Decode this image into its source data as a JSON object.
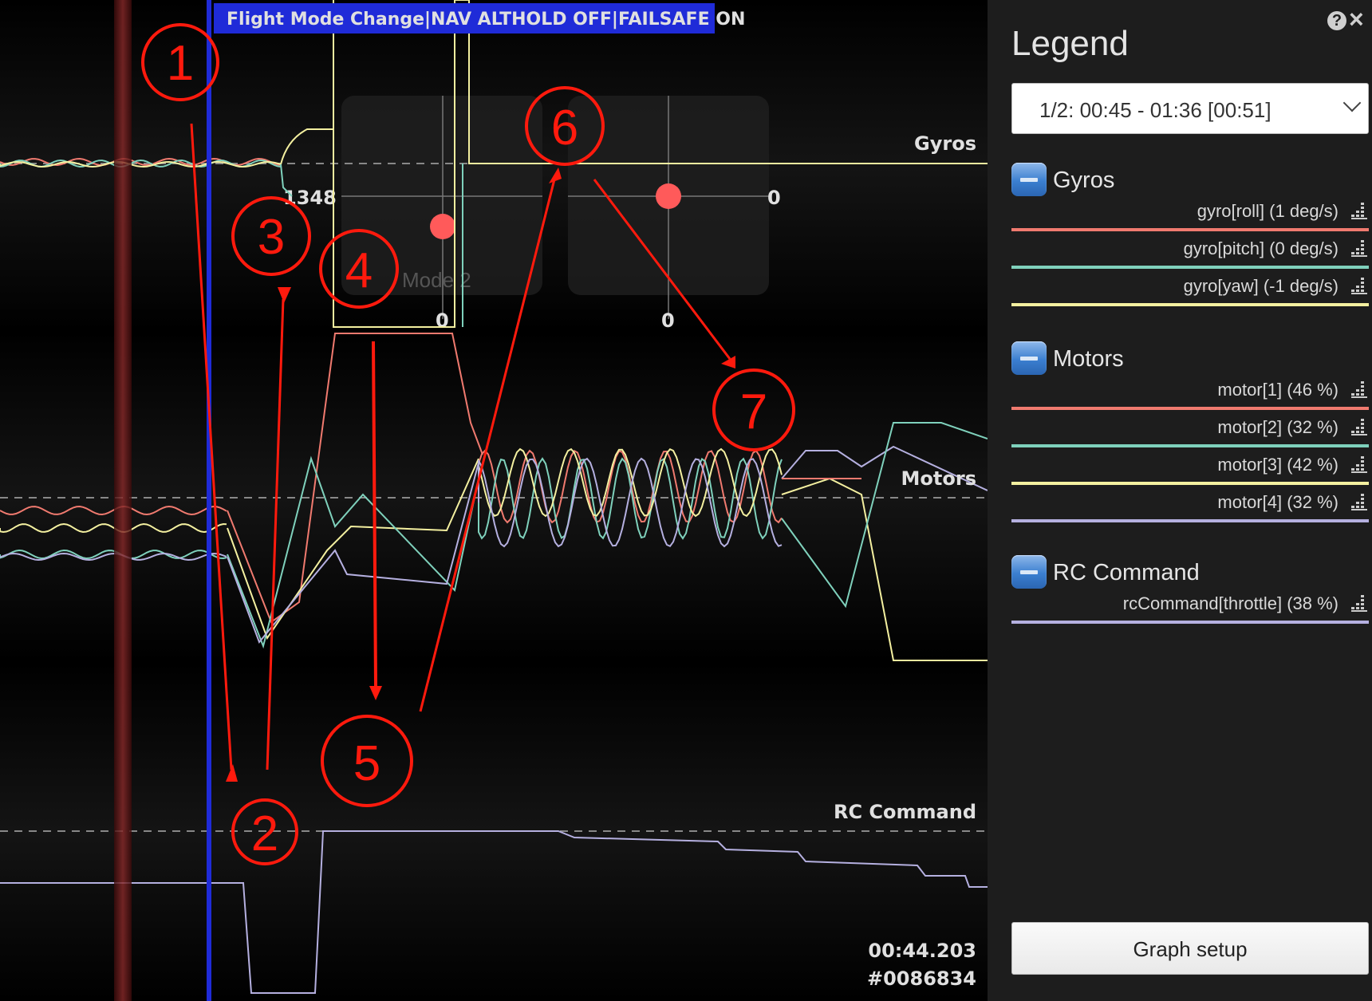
{
  "event_banner": "Flight Mode Change|NAV ALTHOLD OFF|FAILSAFE ON",
  "graph_labels": {
    "gyros": "Gyros",
    "motors": "Motors",
    "rc_command": "RC Command"
  },
  "stick_overlay": {
    "left_value": "1348",
    "left_bottom": "0",
    "right_value": "0",
    "right_bottom": "0",
    "mode": "Mode 2"
  },
  "time_readout": "00:44.203",
  "frame_readout": "#0086834",
  "annotations": [
    "1",
    "2",
    "3",
    "4",
    "5",
    "6",
    "7"
  ],
  "annotation_color": "#ff1a0d",
  "legend": {
    "title": "Legend",
    "help_icon": "question-icon",
    "close_icon": "close-icon",
    "range_selected": "1/2: 00:45 - 01:36 [00:51]",
    "groups": [
      {
        "name": "Gyros",
        "fields": [
          {
            "label": "gyro[roll] (1 deg/s)",
            "color": "#f07a6f"
          },
          {
            "label": "gyro[pitch] (0 deg/s)",
            "color": "#7fd1bc"
          },
          {
            "label": "gyro[yaw] (-1 deg/s)",
            "color": "#f4f0a0"
          }
        ]
      },
      {
        "name": "Motors",
        "fields": [
          {
            "label": "motor[1] (46 %)",
            "color": "#f07a6f"
          },
          {
            "label": "motor[2] (32 %)",
            "color": "#7fd1bc"
          },
          {
            "label": "motor[3] (42 %)",
            "color": "#f4f0a0"
          },
          {
            "label": "motor[4] (32 %)",
            "color": "#b5b0e0"
          }
        ]
      },
      {
        "name": "RC Command",
        "fields": [
          {
            "label": "rcCommand[throttle] (38 %)",
            "color": "#b5b0e0"
          }
        ]
      }
    ],
    "graph_setup": "Graph setup"
  }
}
